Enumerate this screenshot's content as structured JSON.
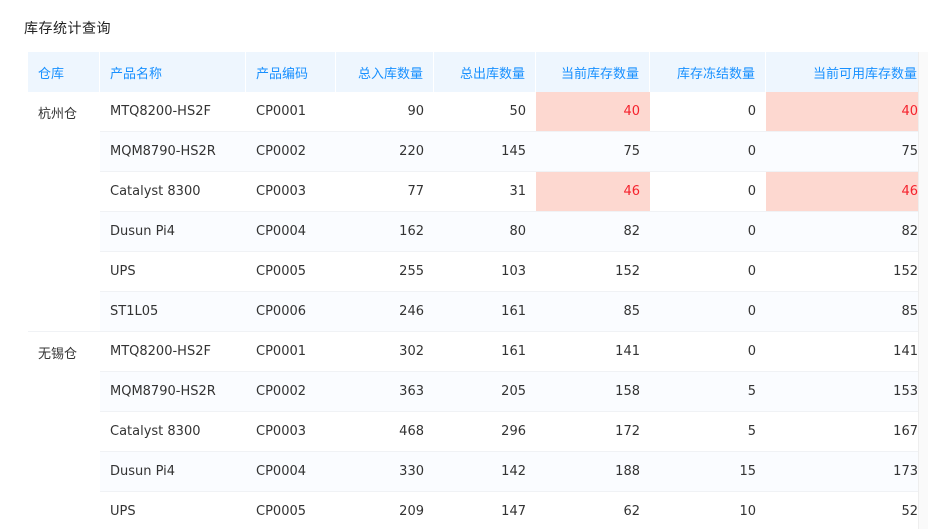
{
  "page": {
    "title": "库存统计查询"
  },
  "colors": {
    "header_bg": "#eef6fe",
    "header_text": "#1890ff",
    "warn_bg": "#fdd8d0",
    "warn_text": "#f5222d"
  },
  "table": {
    "headers": [
      "仓库",
      "产品名称",
      "产品编码",
      "总入库数量",
      "总出库数量",
      "当前库存数量",
      "库存冻结数量",
      "当前可用库存数量"
    ],
    "groups": [
      {
        "warehouse": "杭州仓",
        "rows": [
          {
            "name": "MTQ8200-HS2F",
            "code": "CP0001",
            "in": "90",
            "out": "50",
            "stock": "40",
            "frozen": "0",
            "available": "40",
            "warn": true
          },
          {
            "name": "MQM8790-HS2R",
            "code": "CP0002",
            "in": "220",
            "out": "145",
            "stock": "75",
            "frozen": "0",
            "available": "75",
            "warn": false
          },
          {
            "name": "Catalyst 8300",
            "code": "CP0003",
            "in": "77",
            "out": "31",
            "stock": "46",
            "frozen": "0",
            "available": "46",
            "warn": true
          },
          {
            "name": "Dusun Pi4",
            "code": "CP0004",
            "in": "162",
            "out": "80",
            "stock": "82",
            "frozen": "0",
            "available": "82",
            "warn": false
          },
          {
            "name": "UPS",
            "code": "CP0005",
            "in": "255",
            "out": "103",
            "stock": "152",
            "frozen": "0",
            "available": "152",
            "warn": false
          },
          {
            "name": "ST1L05",
            "code": "CP0006",
            "in": "246",
            "out": "161",
            "stock": "85",
            "frozen": "0",
            "available": "85",
            "warn": false
          }
        ]
      },
      {
        "warehouse": "无锡仓",
        "rows": [
          {
            "name": "MTQ8200-HS2F",
            "code": "CP0001",
            "in": "302",
            "out": "161",
            "stock": "141",
            "frozen": "0",
            "available": "141",
            "warn": false
          },
          {
            "name": "MQM8790-HS2R",
            "code": "CP0002",
            "in": "363",
            "out": "205",
            "stock": "158",
            "frozen": "5",
            "available": "153",
            "warn": false
          },
          {
            "name": "Catalyst 8300",
            "code": "CP0003",
            "in": "468",
            "out": "296",
            "stock": "172",
            "frozen": "5",
            "available": "167",
            "warn": false
          },
          {
            "name": "Dusun Pi4",
            "code": "CP0004",
            "in": "330",
            "out": "142",
            "stock": "188",
            "frozen": "15",
            "available": "173",
            "warn": false
          },
          {
            "name": "UPS",
            "code": "CP0005",
            "in": "209",
            "out": "147",
            "stock": "62",
            "frozen": "10",
            "available": "52",
            "warn": false
          }
        ]
      }
    ]
  }
}
